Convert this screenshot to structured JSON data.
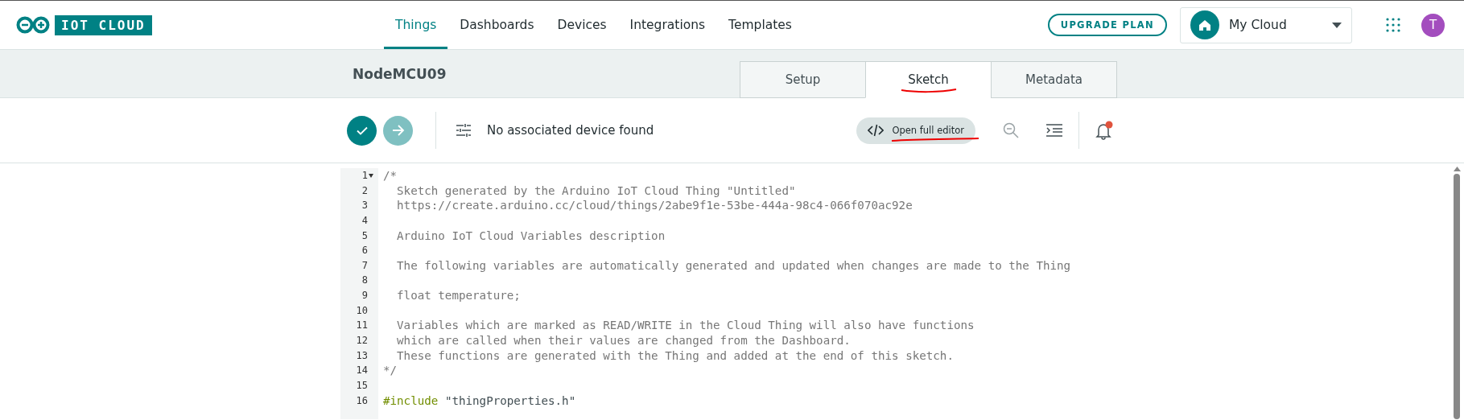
{
  "header": {
    "logo_text": "IOT CLOUD",
    "nav": [
      {
        "label": "Things",
        "selected": true
      },
      {
        "label": "Dashboards",
        "selected": false
      },
      {
        "label": "Devices",
        "selected": false
      },
      {
        "label": "Integrations",
        "selected": false
      },
      {
        "label": "Templates",
        "selected": false
      }
    ],
    "upgrade_button": "UPGRADE PLAN",
    "space_select": {
      "value": "My Cloud"
    },
    "avatar": "T"
  },
  "thing": {
    "title": "NodeMCU09",
    "tabs": [
      {
        "label": "Setup",
        "selected": false,
        "underlined": false
      },
      {
        "label": "Sketch",
        "selected": true,
        "underlined": true
      },
      {
        "label": "Metadata",
        "selected": false,
        "underlined": false
      }
    ]
  },
  "toolbar": {
    "device_status": "No associated device found",
    "editor_button": {
      "label": "Open full editor",
      "underlined": true
    },
    "notification_badge": true
  },
  "editor": {
    "lines": [
      {
        "number": "1",
        "foldable": true,
        "tokens": [
          {
            "kind": "comment",
            "text": "/*"
          }
        ]
      },
      {
        "number": "2",
        "foldable": false,
        "tokens": [
          {
            "kind": "comment",
            "text": "  Sketch generated by the Arduino IoT Cloud Thing \"Untitled\""
          }
        ]
      },
      {
        "number": "3",
        "foldable": false,
        "tokens": [
          {
            "kind": "comment",
            "text": "  https://create.arduino.cc/cloud/things/2abe9f1e-53be-444a-98c4-066f070ac92e"
          }
        ]
      },
      {
        "number": "4",
        "foldable": false
      },
      {
        "number": "5",
        "foldable": false,
        "tokens": [
          {
            "kind": "comment",
            "text": "  Arduino IoT Cloud Variables description"
          }
        ]
      },
      {
        "number": "6",
        "foldable": false
      },
      {
        "number": "7",
        "foldable": false,
        "tokens": [
          {
            "kind": "comment",
            "text": "  The following variables are automatically generated and updated when changes are made to the Thing"
          }
        ]
      },
      {
        "number": "8",
        "foldable": false
      },
      {
        "number": "9",
        "foldable": false,
        "tokens": [
          {
            "kind": "comment",
            "text": "  float temperature;"
          }
        ]
      },
      {
        "number": "10",
        "foldable": false
      },
      {
        "number": "11",
        "foldable": false,
        "tokens": [
          {
            "kind": "comment",
            "text": "  Variables which are marked as READ/WRITE in the Cloud Thing will also have functions"
          }
        ]
      },
      {
        "number": "12",
        "foldable": false,
        "tokens": [
          {
            "kind": "comment",
            "text": "  which are called when their values are changed from the Dashboard."
          }
        ]
      },
      {
        "number": "13",
        "foldable": false,
        "tokens": [
          {
            "kind": "comment",
            "text": "  These functions are generated with the Thing and added at the end of this sketch."
          }
        ]
      },
      {
        "number": "14",
        "foldable": false,
        "tokens": [
          {
            "kind": "comment",
            "text": "*/"
          }
        ]
      },
      {
        "number": "15",
        "foldable": false
      },
      {
        "number": "16",
        "foldable": false,
        "tokens": [
          {
            "kind": "keyword",
            "text": "#include"
          },
          {
            "kind": "string",
            "text": "\"thingProperties.h\""
          }
        ]
      }
    ]
  }
}
